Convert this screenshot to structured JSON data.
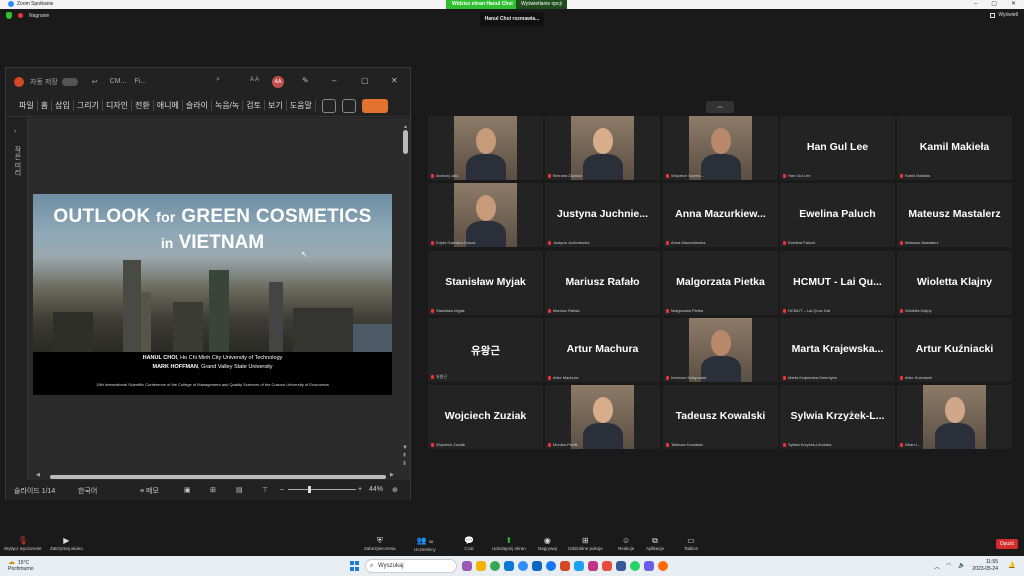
{
  "window": {
    "title": "Zoom Spotkanie",
    "share_label": "Widzisz ekran Hanul Choi",
    "view_options": "Wyświetlanie opcji",
    "recording": "Nagranie",
    "speaker_label": "Hanul Choi rozmawia...",
    "view_button": "Wyświetl"
  },
  "ppt": {
    "autosave": "자동 저장",
    "filename": "CM...",
    "filename2": "Fi...",
    "aa_label": "A A",
    "avatar": "AA",
    "ribbon": [
      "파일",
      "홈",
      "삽입",
      "그리기",
      "디자인",
      "전환",
      "애니메",
      "슬라이",
      "녹음/녹",
      "검토",
      "보기",
      "도움말"
    ],
    "side_label": "작은 미리",
    "slide": {
      "title_line1_big_a": "OUTLOOK",
      "title_line1_small": "for",
      "title_line1_big_b": "GREEN COSMETICS",
      "title_line2_small": "in",
      "title_line2_big": "VIETNAM",
      "author1_name": "HANUL CHOI",
      "author1_aff": ", Ho Chi Minh City University of Technology",
      "author2_name": "MARK HOFFMAN",
      "author2_aff": ", Grand Valley State University",
      "conference": "15th International Scientific Conference of the College of Management and Quality Sciences of the Cracow University of Economics"
    },
    "status": {
      "slide": "슬라이드 1/14",
      "lang": "한국어",
      "notes": "메모",
      "zoom": "44%"
    }
  },
  "gallery": {
    "collapse_icon": "chevron-up-icon",
    "tiles": [
      {
        "name": "",
        "label": "Andrzej Jaki",
        "video": true
      },
      {
        "name": "",
        "label": "Bernard Ziębicki",
        "video": true
      },
      {
        "name": "",
        "label": "Wojciech Szyma...",
        "video": true
      },
      {
        "name": "Han Gul Lee",
        "label": "Han Gul Lee",
        "video": false
      },
      {
        "name": "Kamil Makieła",
        "label": "Kamil Makieła",
        "video": false
      },
      {
        "name": "",
        "label": "Edyta Gwińska-Dusza",
        "video": true
      },
      {
        "name": "Justyna Juchnie...",
        "label": "Justyna Juchniewicz",
        "video": false
      },
      {
        "name": "Anna Mazurkiew...",
        "label": "Anna Mazurkiewicz",
        "video": false
      },
      {
        "name": "Ewelina Paluch",
        "label": "Ewelina Paluch",
        "video": false
      },
      {
        "name": "Mateusz Mastalerz",
        "label": "Mateusz Mastalerz",
        "video": false
      },
      {
        "name": "Stanisław Myjak",
        "label": "Stanisław Myjak",
        "video": false
      },
      {
        "name": "Mariusz Rafało",
        "label": "Mariusz Rafało",
        "video": false
      },
      {
        "name": "Malgorzata Pietka",
        "label": "Malgorzata Pietka",
        "video": false
      },
      {
        "name": "HCMUT - Lai Qu...",
        "label": "HCMUT – Lai Quoc Dat",
        "video": false
      },
      {
        "name": "Wioletta Klajny",
        "label": "Wioletta Klajny",
        "video": false
      },
      {
        "name": "유왕근",
        "label": "유왕근",
        "video": false
      },
      {
        "name": "Artur Machura",
        "label": "Artur Machura",
        "video": false
      },
      {
        "name": "",
        "label": "Ireneusz Kuligowski",
        "video": true
      },
      {
        "name": "Marta Krajewska...",
        "label": "Marta Krajewska-Smentyes",
        "video": false
      },
      {
        "name": "Artur Kuźniacki",
        "label": "Artur Kuźniacki",
        "video": false
      },
      {
        "name": "Wojciech Zuziak",
        "label": "Wojciech Zuziak",
        "video": false
      },
      {
        "name": "",
        "label": "Monika Pavlik",
        "video": true
      },
      {
        "name": "Tadeusz Kowalski",
        "label": "Tadeusz Kowalski",
        "video": false
      },
      {
        "name": "Sylwia Krzyżek-L...",
        "label": "Sylwia Krzyżek-Liburska",
        "video": false
      },
      {
        "name": "",
        "label": "Nhan L...",
        "video": true
      }
    ]
  },
  "toolbar": {
    "mute": "Wyłącz wyciszenie",
    "video": "Zatrzymaj wideo",
    "security": "Zabezpieczenia",
    "participants": "Uczestnicy",
    "participants_count": "36",
    "chat": "Czat",
    "share": "Udostępnij ekran",
    "record": "Nagrywaj",
    "rooms": "Oddzielne pokoje",
    "reactions": "Reakcje",
    "apps": "Aplikacje",
    "whiteboard": "Tablice",
    "end": "Opuść"
  },
  "taskbar": {
    "temp": "15°C",
    "weather": "Pochmurno",
    "search": "Wyszukaj",
    "time": "11:55",
    "date": "2023-05-24"
  },
  "colors": {
    "share_green": "#2fbf2f",
    "end_red": "#d42b2b",
    "ppt_orange": "#e3722f"
  }
}
